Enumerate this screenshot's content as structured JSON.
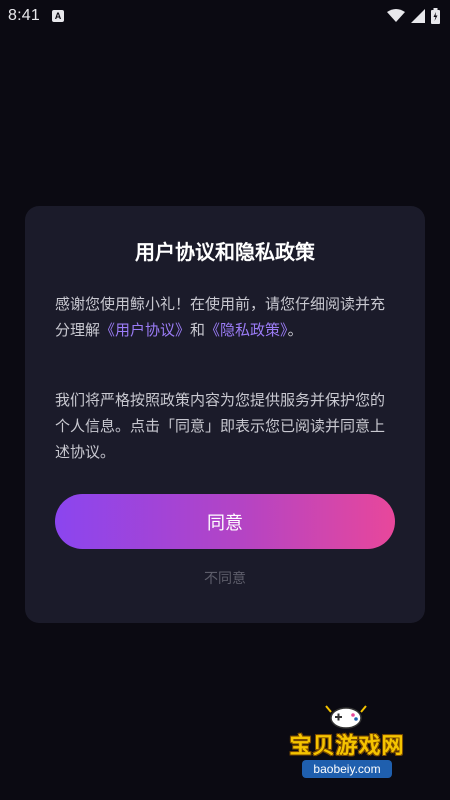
{
  "status_bar": {
    "time": "8:41",
    "notification_glyph": "A",
    "icons": [
      "wifi-icon",
      "signal-icon",
      "battery-icon"
    ]
  },
  "dialog": {
    "title": "用户协议和隐私政策",
    "para1": {
      "text_before": "感谢您使用鲸小礼！在使用前，请您仔细阅读并充分理解",
      "user_agreement_link": "《用户协议》",
      "text_middle": "和",
      "privacy_policy_link": "《隐私政策》",
      "text_after": "。"
    },
    "para2": "我们将严格按照政策内容为您提供服务并保护您的个人信息。点击「同意」即表示您已阅读并同意上述协议。",
    "agree_label": "同意",
    "disagree_label": "不同意"
  },
  "watermark": {
    "title": "宝贝游戏网",
    "url": "baobeiy.com"
  },
  "colors": {
    "background": "#0b0a12",
    "dialog_bg": "#1b1b2a",
    "link": "#9b7cf6",
    "button_gradient_start": "#8b45ef",
    "button_gradient_end": "#e8479b",
    "secondary_text": "#5d5d6a"
  }
}
